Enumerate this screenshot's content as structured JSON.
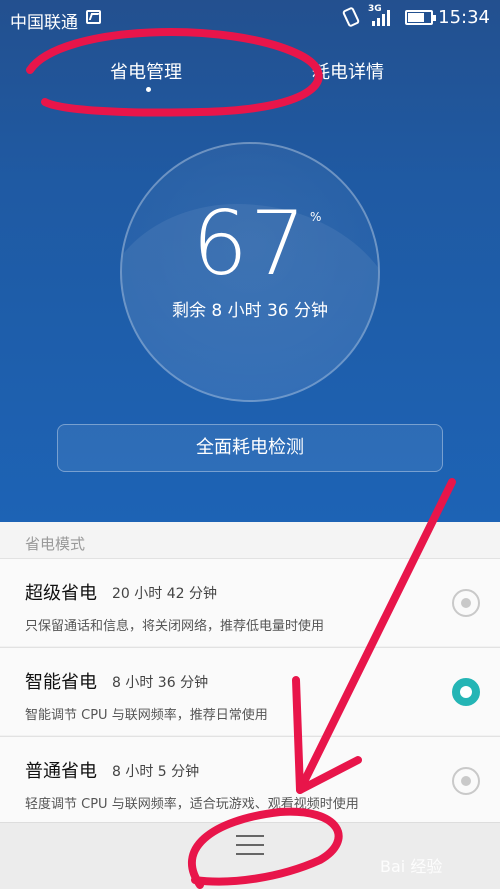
{
  "status": {
    "carrier": "中国联通",
    "network": "3G",
    "time": "15:34"
  },
  "tabs": [
    {
      "label": "省电管理",
      "active": true
    },
    {
      "label": "耗电详情",
      "active": false
    }
  ],
  "battery": {
    "percent": "67",
    "percent_symbol": "%",
    "remaining": "剩余 8 小时 36 分钟"
  },
  "full_check_label": "全面耗电检测",
  "section_title": "省电模式",
  "modes": [
    {
      "name": "超级省电",
      "duration": "20 小时 42 分钟",
      "description": "只保留通话和信息，将关闭网络，推荐低电量时使用",
      "selected": false
    },
    {
      "name": "智能省电",
      "duration": "8 小时 36 分钟",
      "description": "智能调节 CPU 与联网频率，推荐日常使用",
      "selected": true
    },
    {
      "name": "普通省电",
      "duration": "8 小时 5 分钟",
      "description": "轻度调节 CPU 与联网频率，适合玩游戏、观看视频时使用",
      "selected": false
    }
  ],
  "watermark": "Bai 经验",
  "colors": {
    "header_blue": "#1f5aa3",
    "accent_teal": "#24b5b5",
    "annotation_red": "#e8154a"
  },
  "icons": [
    "image-icon",
    "vibrate-icon",
    "signal-icon",
    "battery-icon",
    "radio-icon",
    "menu-icon"
  ]
}
